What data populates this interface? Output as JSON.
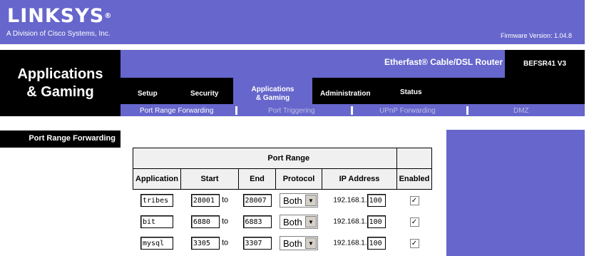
{
  "header": {
    "logo": "LINKSYS",
    "logo_mark": "®",
    "division": "A Division of Cisco Systems, Inc.",
    "firmware": "Firmware Version: 1.04.8"
  },
  "section_title_line1": "Applications",
  "section_title_line2": "& Gaming",
  "product_name": "Etherfast® Cable/DSL Router",
  "model": "BEFSR41 V3",
  "tabs": {
    "setup": "Setup",
    "security": "Security",
    "apps_line1": "Applications",
    "apps_line2": "& Gaming",
    "admin": "Administration",
    "status": "Status"
  },
  "subtabs": {
    "prf": "Port Range Forwarding",
    "pt": "Port Triggering",
    "upnp": "UPnP Forwarding",
    "dmz": "DMZ"
  },
  "left_nav_label": "Port Range Forwarding",
  "table": {
    "group_header": "Port Range",
    "headers": {
      "application": "Application",
      "start": "Start",
      "end": "End",
      "protocol": "Protocol",
      "ip": "IP Address",
      "enabled": "Enabled"
    },
    "to_label": "to",
    "ip_prefix": "192.168.1.",
    "rows": [
      {
        "app": "tribes",
        "start": "28001",
        "end": "28007",
        "protocol": "Both",
        "ip": "100",
        "enabled": "✓"
      },
      {
        "app": "bit",
        "start": "6880",
        "end": "6883",
        "protocol": "Both",
        "ip": "100",
        "enabled": "✓"
      },
      {
        "app": "mysql",
        "start": "3305",
        "end": "3307",
        "protocol": "Both",
        "ip": "100",
        "enabled": "✓"
      }
    ]
  },
  "colors": {
    "brand_purple": "#6666cc",
    "black": "#000000"
  }
}
